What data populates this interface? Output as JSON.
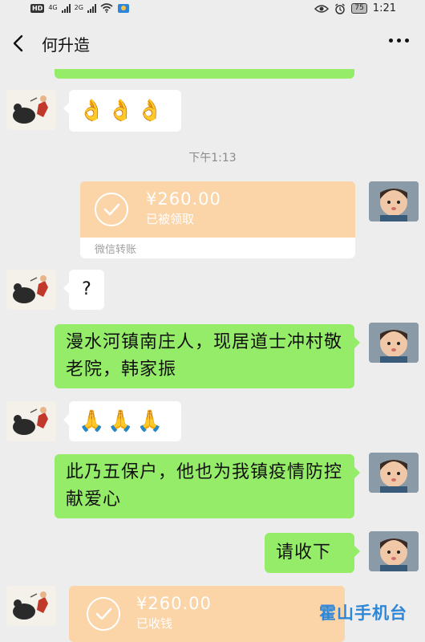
{
  "status_bar": {
    "hd": "HD",
    "sim1_net": "4G",
    "sim2_net": "2G",
    "battery": "75",
    "time": "1:21"
  },
  "header": {
    "title": "何升造"
  },
  "messages": {
    "emoji_1": "👌👌👌",
    "time_divider": "下午1:13",
    "transfer_1": {
      "amount": "¥260.00",
      "status": "已被领取",
      "footer": "微信转账"
    },
    "question": "?",
    "msg_1": "漫水河镇南庄人，现居道士冲村敬老院，韩家振",
    "emoji_2": "🙏🙏🙏",
    "msg_2": "此乃五保户，他也为我镇疫情防控献爱心",
    "msg_3": "请收下",
    "transfer_2": {
      "amount": "¥260.00",
      "status": "已收钱"
    }
  },
  "watermark": "霍山手机台",
  "colors": {
    "background": "#ededed",
    "green_bubble": "#95ec69",
    "transfer": "#fbd4a8",
    "watermark": "#2e86d8"
  }
}
